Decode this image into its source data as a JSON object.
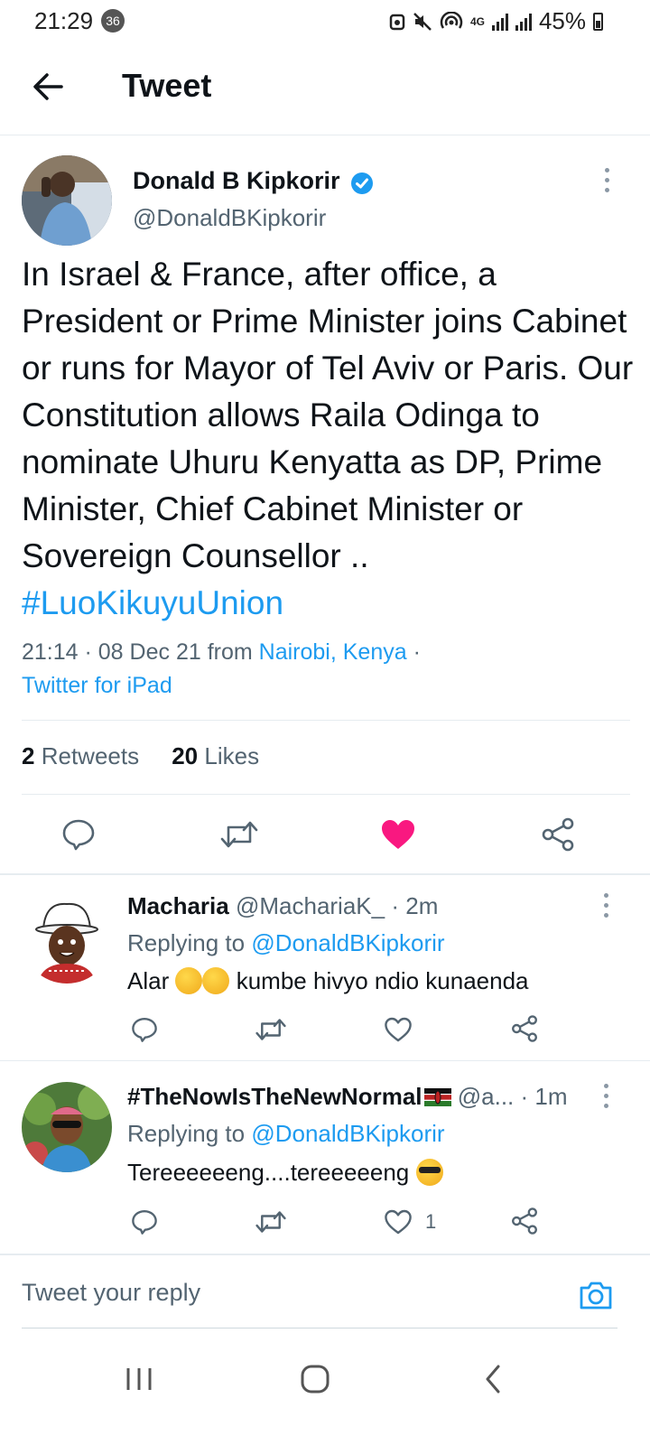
{
  "status_bar": {
    "time": "21:29",
    "notification_count": "36",
    "network": "4G",
    "battery": "45%"
  },
  "header": {
    "title": "Tweet"
  },
  "tweet": {
    "author_name": "Donald B Kipkorir",
    "author_handle": "@DonaldBKipkorir",
    "text": "In Israel & France, after office, a President or Prime Minister joins Cabinet or runs for Mayor of Tel Aviv or Paris. Our Constitution allows Raila Odinga to nominate Uhuru Kenyatta as DP, Prime Minister, Chief Cabinet Minister or Sovereign Counsellor .. ",
    "hashtag": "#LuoKikuyuUnion",
    "time": "21:14",
    "date": "08 Dec 21",
    "from_label": "from",
    "location": "Nairobi, Kenya",
    "source": "Twitter for iPad",
    "retweets_count": "2",
    "retweets_label": "Retweets",
    "likes_count": "20",
    "likes_label": "Likes",
    "liked": true
  },
  "replies": [
    {
      "name": "Macharia",
      "handle": "@MachariaK_",
      "time": "2m",
      "replying_label": "Replying to",
      "replying_to": "@DonaldBKipkorir",
      "text_before": "Alar",
      "text_after": "kumbe hivyo ndio kunaenda",
      "like_count": ""
    },
    {
      "name": "#TheNowIsTheNewNormal",
      "handle": "@a...",
      "time": "1m",
      "replying_label": "Replying to",
      "replying_to": "@DonaldBKipkorir",
      "text_before": "Tereeeeeeng....tereeeeeng",
      "text_after": "",
      "like_count": "1"
    }
  ],
  "compose": {
    "placeholder": "Tweet your reply"
  },
  "colors": {
    "accent": "#1d9bf0",
    "like": "#f91880",
    "muted": "#536471"
  },
  "icons": {
    "back": "arrow-left-icon",
    "reply": "speech-bubble-icon",
    "retweet": "retweet-icon",
    "like": "heart-icon",
    "share": "share-icon",
    "camera": "camera-icon"
  }
}
